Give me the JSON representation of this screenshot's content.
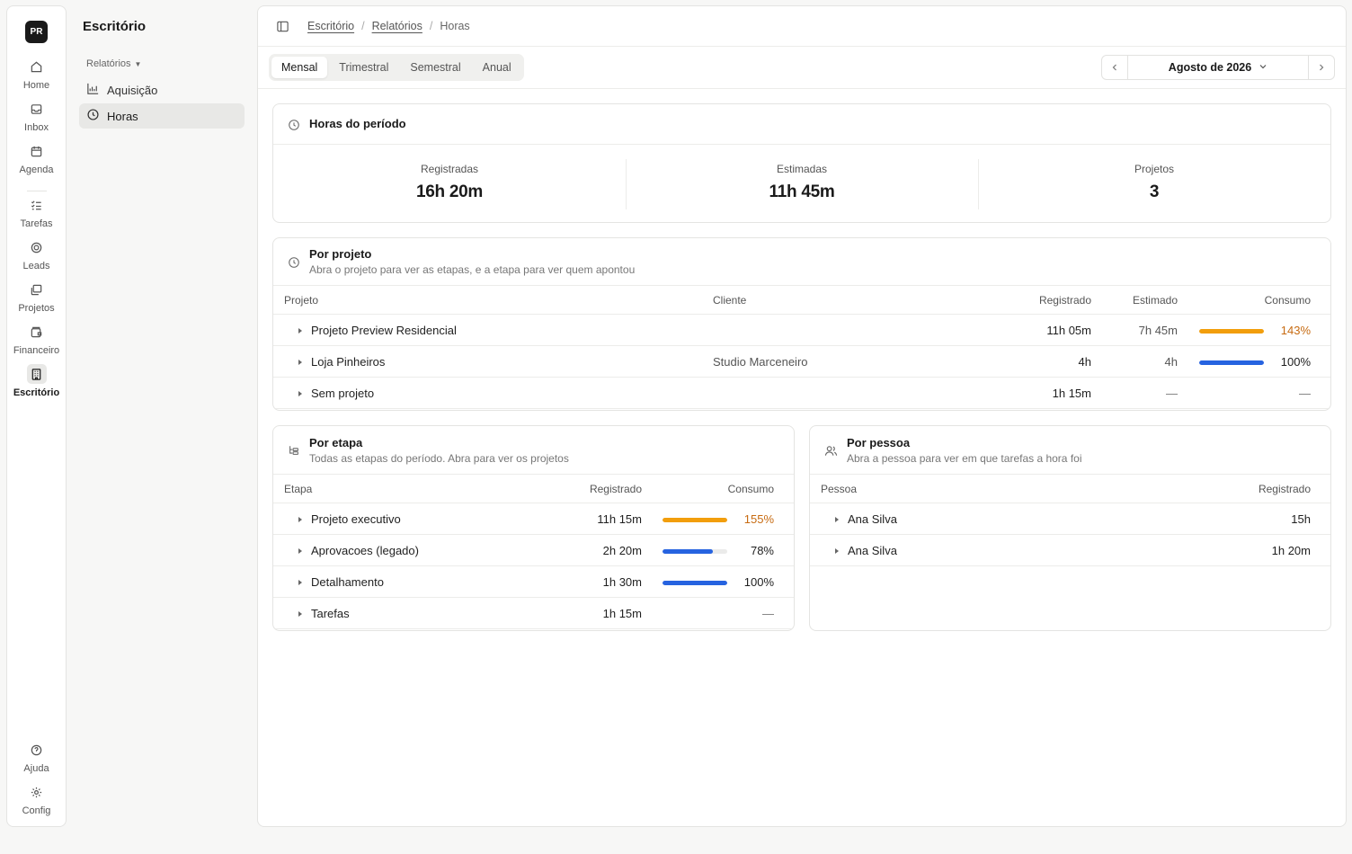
{
  "rail": {
    "logo": "PR",
    "items": [
      {
        "label": "Home",
        "icon": "home-icon"
      },
      {
        "label": "Inbox",
        "icon": "inbox-icon"
      },
      {
        "label": "Agenda",
        "icon": "calendar-icon"
      },
      {
        "label": "Tarefas",
        "icon": "tasks-icon"
      },
      {
        "label": "Leads",
        "icon": "target-icon"
      },
      {
        "label": "Projetos",
        "icon": "folders-icon"
      },
      {
        "label": "Financeiro",
        "icon": "wallet-icon"
      },
      {
        "label": "Escritório",
        "icon": "building-icon",
        "active": true
      },
      {
        "label": "Ajuda",
        "icon": "help-icon"
      },
      {
        "label": "Config",
        "icon": "gear-icon"
      }
    ]
  },
  "sidebar": {
    "title": "Escritório",
    "group": "Relatórios",
    "items": [
      {
        "label": "Aquisição",
        "icon": "chart-icon"
      },
      {
        "label": "Horas",
        "icon": "clock-icon",
        "active": true
      }
    ]
  },
  "breadcrumb": [
    "Escritório",
    "Relatórios",
    "Horas"
  ],
  "tabs": [
    "Mensal",
    "Trimestral",
    "Semestral",
    "Anual"
  ],
  "active_tab": "Mensal",
  "period": "Agosto de 2026",
  "summary": {
    "title": "Horas do período",
    "stats": [
      {
        "label": "Registradas",
        "value": "16h 20m"
      },
      {
        "label": "Estimadas",
        "value": "11h 45m"
      },
      {
        "label": "Projetos",
        "value": "3"
      }
    ]
  },
  "projects": {
    "title": "Por projeto",
    "subtitle": "Abra o projeto para ver as etapas, e a etapa para ver quem apontou",
    "columns": [
      "Projeto",
      "Cliente",
      "Registrado",
      "Estimado",
      "Consumo"
    ],
    "rows": [
      {
        "name": "Projeto Preview Residencial",
        "client": "",
        "registered": "11h 05m",
        "estimated": "7h 45m",
        "consumo": "143%",
        "fill": 1.0,
        "over": true
      },
      {
        "name": "Loja Pinheiros",
        "client": "Studio Marceneiro",
        "registered": "4h",
        "estimated": "4h",
        "consumo": "100%",
        "fill": 1.0,
        "over": false
      },
      {
        "name": "Sem projeto",
        "client": "",
        "registered": "1h 15m",
        "estimated": "—",
        "consumo": "—",
        "fill": null,
        "over": false
      }
    ]
  },
  "stages": {
    "title": "Por etapa",
    "subtitle": "Todas as etapas do período. Abra para ver os projetos",
    "columns": [
      "Etapa",
      "Registrado",
      "Consumo"
    ],
    "rows": [
      {
        "name": "Projeto executivo",
        "registered": "11h 15m",
        "consumo": "155%",
        "fill": 1.0,
        "over": true
      },
      {
        "name": "Aprovacoes (legado)",
        "registered": "2h 20m",
        "consumo": "78%",
        "fill": 0.78,
        "over": false
      },
      {
        "name": "Detalhamento",
        "registered": "1h 30m",
        "consumo": "100%",
        "fill": 1.0,
        "over": false
      },
      {
        "name": "Tarefas",
        "registered": "1h 15m",
        "consumo": "—",
        "fill": null,
        "over": false
      }
    ]
  },
  "people": {
    "title": "Por pessoa",
    "subtitle": "Abra a pessoa para ver em que tarefas a hora foi",
    "columns": [
      "Pessoa",
      "Registrado"
    ],
    "rows": [
      {
        "name": "Ana Silva",
        "registered": "15h"
      },
      {
        "name": "Ana Silva",
        "registered": "1h 20m"
      }
    ]
  },
  "colors": {
    "over": "#f29e0c",
    "normal": "#2663e0",
    "over_text": "#c76b12"
  }
}
